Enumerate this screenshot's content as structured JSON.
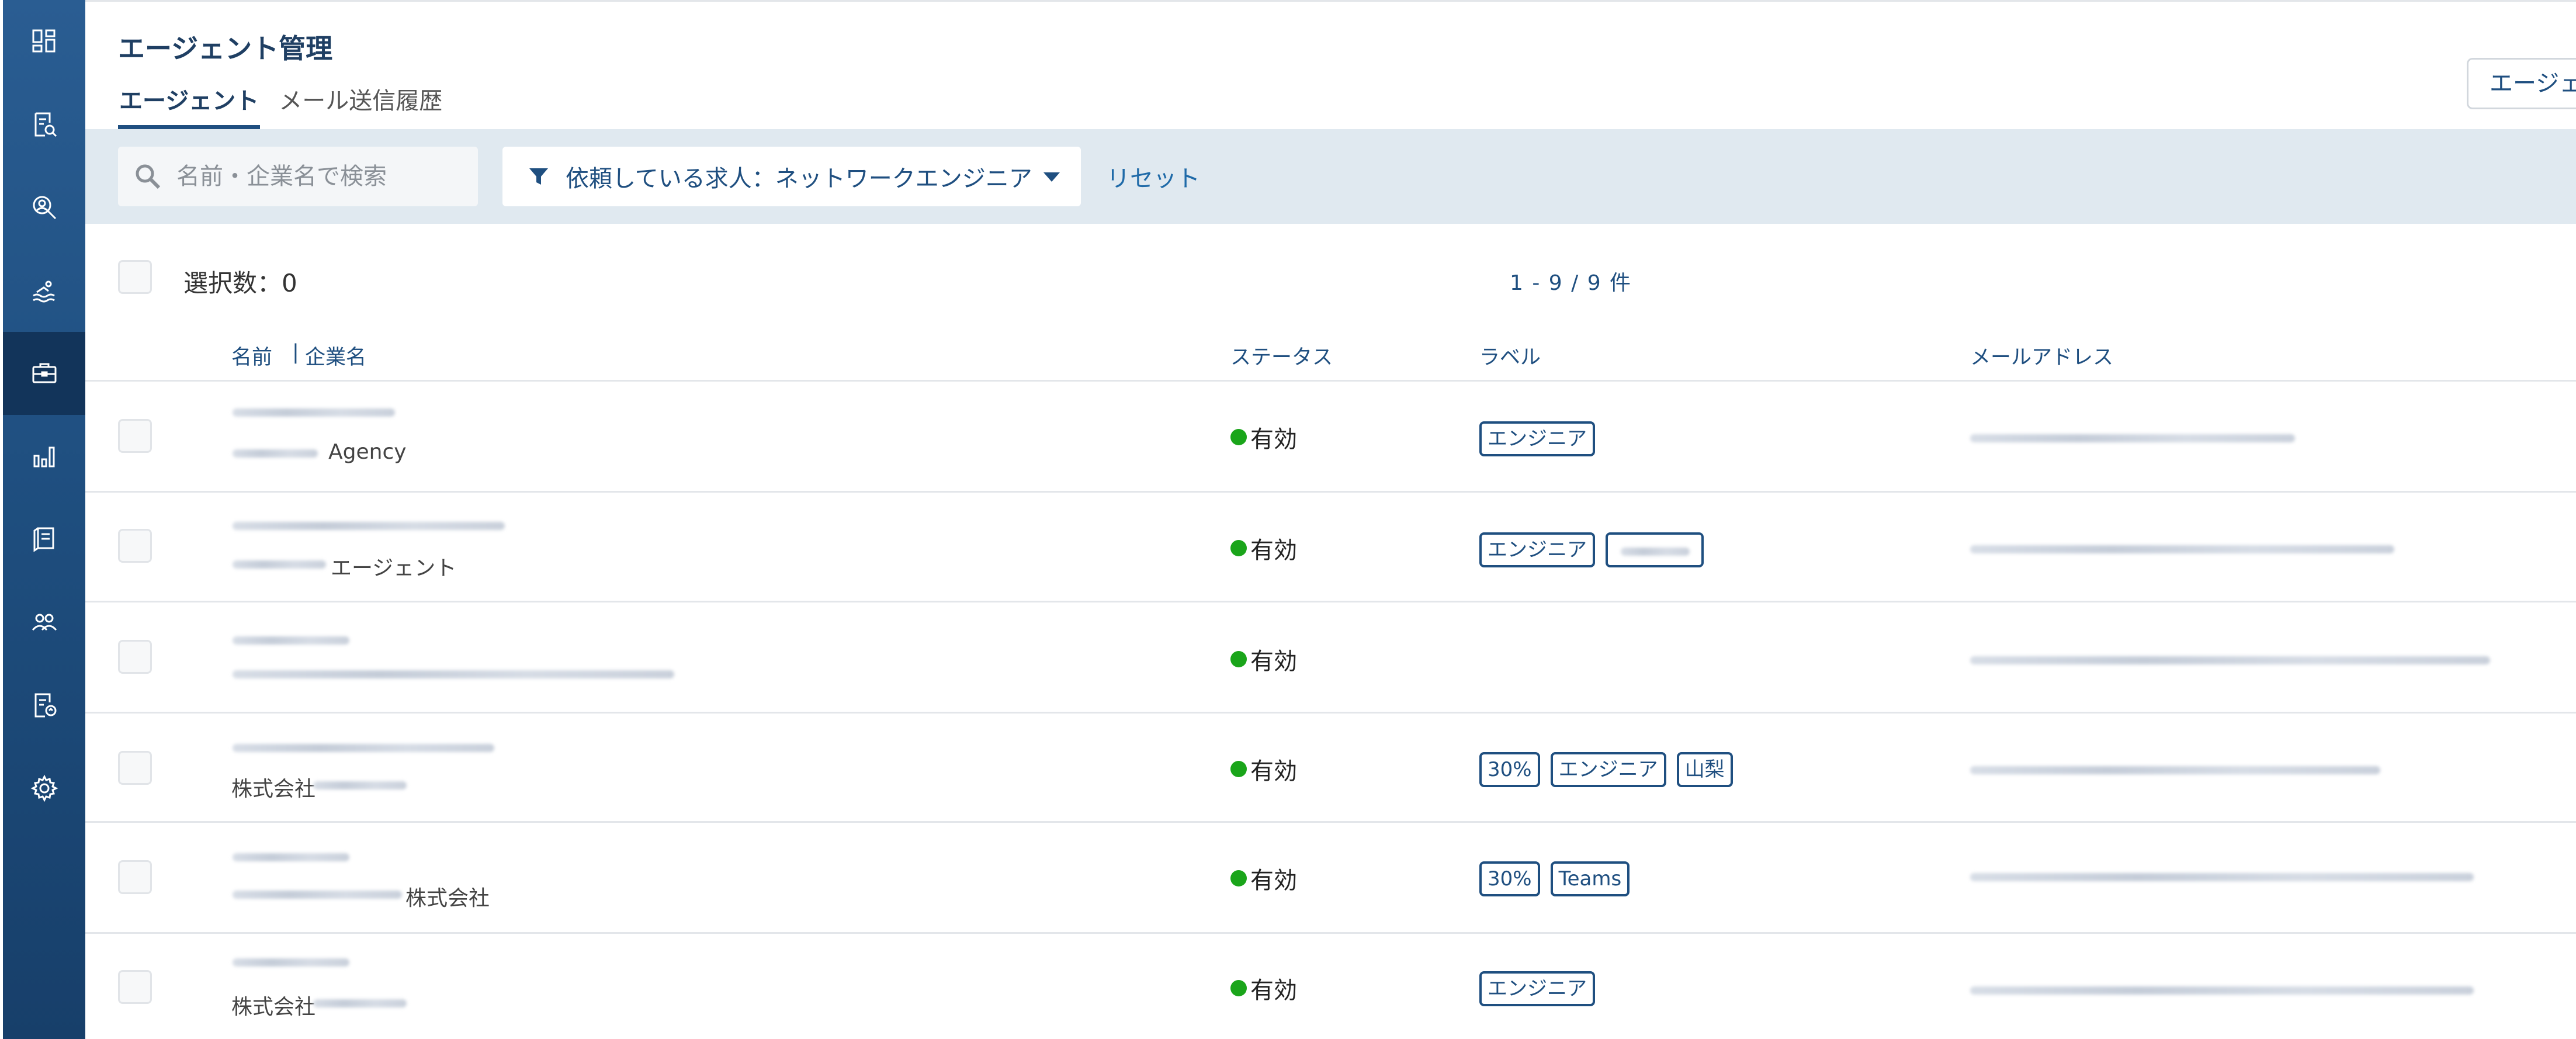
{
  "page": {
    "title": "エージェント管理"
  },
  "tabs": [
    {
      "label": "エージェント",
      "active": true
    },
    {
      "label": "メール送信履歴",
      "active": false
    }
  ],
  "header": {
    "right_button_label": "エージェ"
  },
  "filter": {
    "search_placeholder": "名前・企業名で検索",
    "filter_label": "依頼している求人：ネットワークエンジニア",
    "reset_label": "リセット"
  },
  "toolbar": {
    "selected_count": "選択数：0",
    "pagination": "1 - 9 / 9 件"
  },
  "table": {
    "columns": {
      "name": "名前",
      "company": "企業名",
      "status": "ステータス",
      "label": "ラベル",
      "email": "メールアドレス"
    },
    "rows": [
      {
        "company_visible": "Agency",
        "status": "有効",
        "labels": [
          "エンジニア"
        ]
      },
      {
        "company_visible": "エージェント",
        "status": "有効",
        "labels": [
          "エンジニア"
        ]
      },
      {
        "company_visible": "",
        "status": "有効",
        "labels": []
      },
      {
        "company_visible": "株式会社",
        "status": "有効",
        "labels": [
          "30%",
          "エンジニア",
          "山梨"
        ]
      },
      {
        "company_visible": "株式会社",
        "status": "有効",
        "labels": [
          "30%",
          "Teams"
        ]
      },
      {
        "company_visible": "株式会社",
        "status": "有効",
        "labels": [
          "エンジニア"
        ]
      }
    ]
  },
  "sidebar": {
    "items": [
      {
        "icon": "dashboard-icon"
      },
      {
        "icon": "document-search-icon"
      },
      {
        "icon": "person-search-icon"
      },
      {
        "icon": "swimmer-icon"
      },
      {
        "icon": "briefcase-icon",
        "active": true
      },
      {
        "icon": "bar-chart-icon"
      },
      {
        "icon": "book-icon"
      },
      {
        "icon": "people-icon"
      },
      {
        "icon": "document-refresh-icon"
      },
      {
        "icon": "gear-icon"
      }
    ]
  },
  "colors": {
    "sidebar": "#1f4f80",
    "accent": "#1f4f80",
    "status_active": "#1aa51a",
    "filter_bg": "#e0e9f0"
  }
}
